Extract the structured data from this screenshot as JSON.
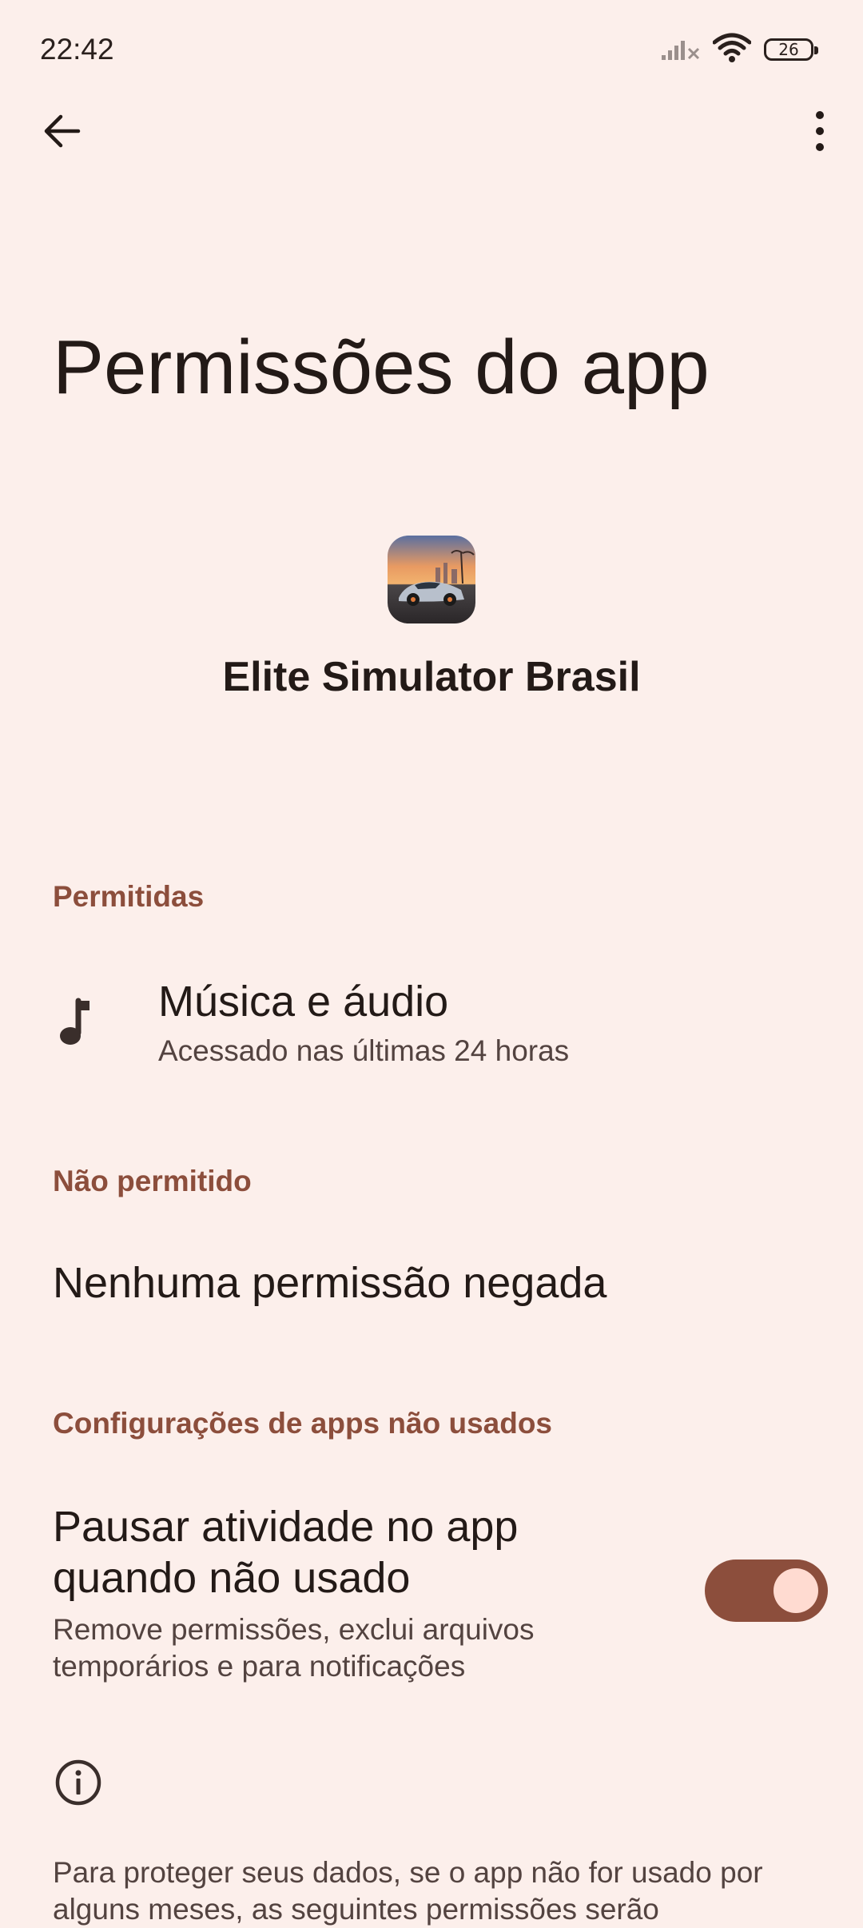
{
  "status_bar": {
    "time": "22:42",
    "battery": "26",
    "icons": [
      "signal-off-icon",
      "wifi-icon",
      "battery-icon"
    ]
  },
  "top_bar": {
    "icons": [
      "arrow-back-icon",
      "more-vert-icon"
    ]
  },
  "page": {
    "title": "Permissões do app"
  },
  "app": {
    "name": "Elite Simulator Brasil"
  },
  "sections": {
    "allowed": {
      "header": "Permitidas",
      "items": [
        {
          "title": "Música e áudio",
          "subtitle": "Acessado nas últimas 24 horas",
          "icon": "music-note-icon"
        }
      ]
    },
    "denied": {
      "header": "Não permitido",
      "empty_text": "Nenhuma permissão negada"
    },
    "unused": {
      "header": "Configurações de apps não usados",
      "pause_title": "Pausar atividade no app quando não usado",
      "pause_subtitle": "Remove permissões, exclui arquivos temporários e para notificações",
      "pause_enabled": true,
      "info_icon": "info-icon",
      "footer": "Para proteger seus dados, se o app não for usado por alguns meses, as seguintes permissões serão"
    }
  },
  "colors": {
    "background": "#fcefeb",
    "accent": "#8c4e3c",
    "toggle_thumb": "#ffdbd1",
    "text_primary": "#231a17",
    "text_secondary": "#534340"
  }
}
